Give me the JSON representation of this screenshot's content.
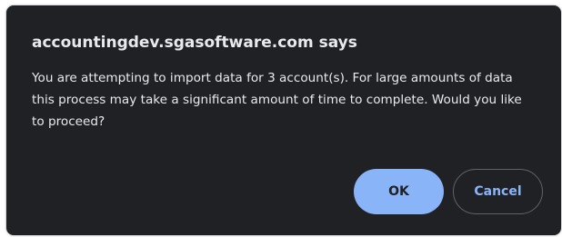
{
  "dialog": {
    "title": "accountingdev.sgasoftware.com says",
    "message": "You are attempting to import data for 3 account(s). For large amounts of data this process may take a significant amount of time to complete. Would you like to proceed?",
    "ok_label": "OK",
    "cancel_label": "Cancel"
  },
  "colors": {
    "dialog_background": "#202124",
    "text": "#e8eaed",
    "accent": "#8ab4f8",
    "cancel_border": "#5f6368"
  }
}
